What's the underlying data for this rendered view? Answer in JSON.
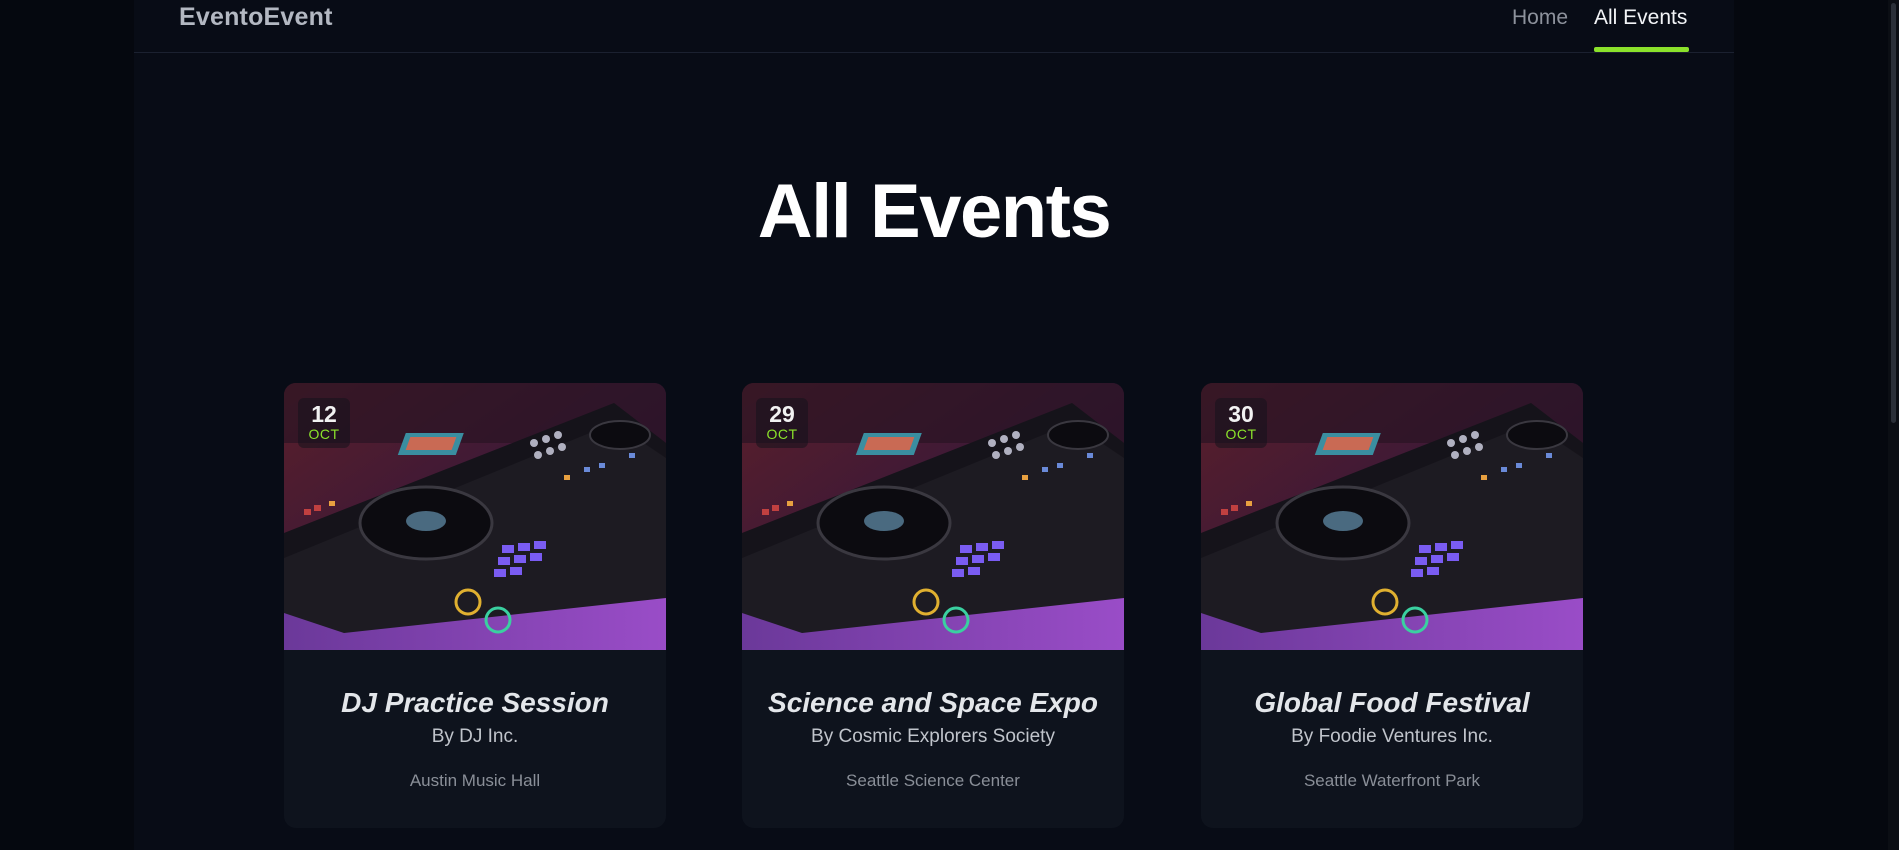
{
  "brand": "EventoEvent",
  "nav": {
    "home": "Home",
    "all_events": "All Events"
  },
  "page_title": "All Events",
  "events": [
    {
      "day": "12",
      "month": "OCT",
      "title": "DJ Practice Session",
      "organizer": "By DJ Inc.",
      "location": "Austin Music Hall"
    },
    {
      "day": "29",
      "month": "OCT",
      "title": "Science and Space Expo",
      "organizer": "By Cosmic Explorers Society",
      "location": "Seattle Science Center"
    },
    {
      "day": "30",
      "month": "OCT",
      "title": "Global Food Festival",
      "organizer": "By Foodie Ventures Inc.",
      "location": "Seattle Waterfront Park"
    }
  ],
  "colors": {
    "accent": "#8be22b",
    "background": "#080c16",
    "card": "#0e131d"
  }
}
